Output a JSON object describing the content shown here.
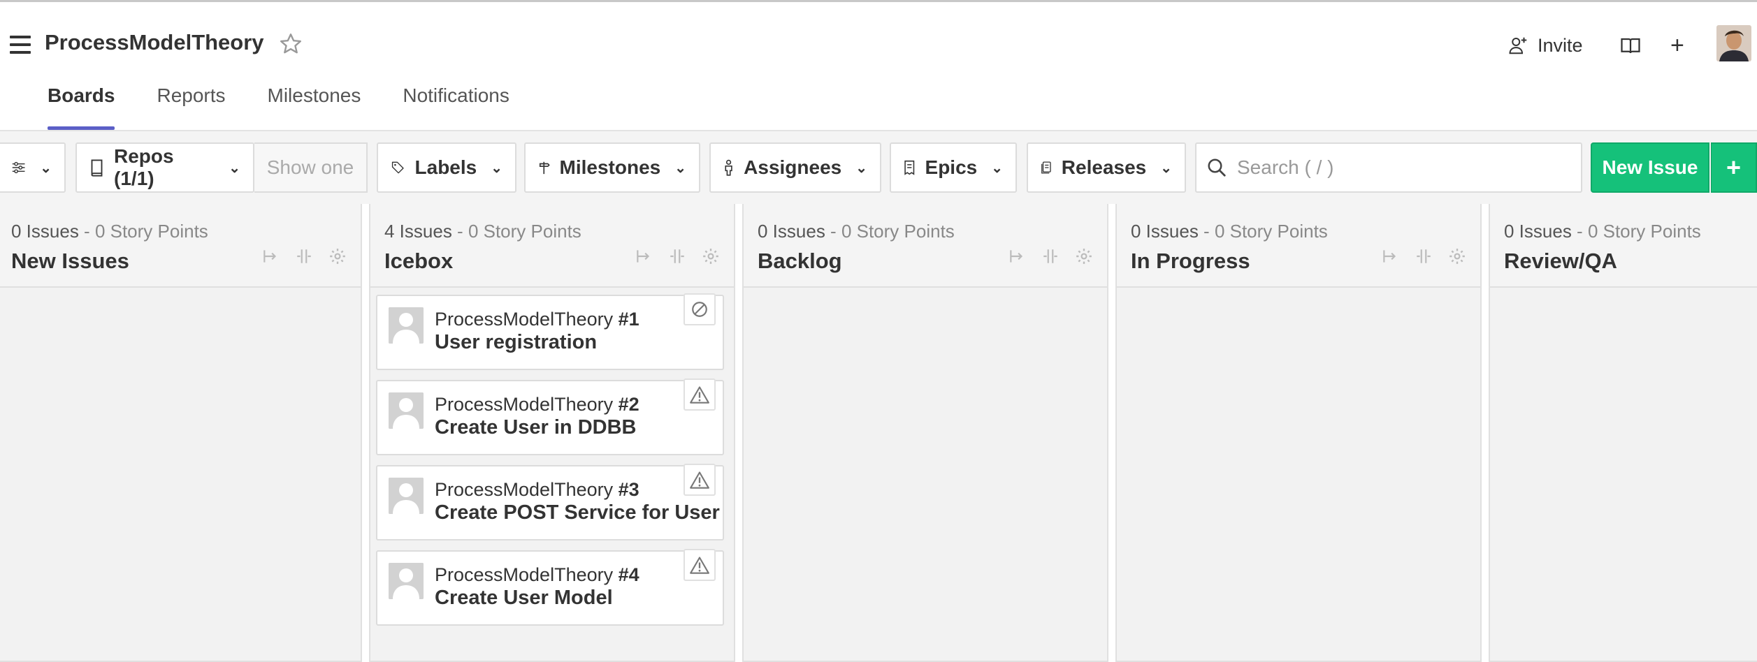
{
  "header": {
    "board_title": "ProcessModelTheory",
    "invite_label": "Invite",
    "icons": [
      "hamburger-menu-icon",
      "star-icon",
      "add-user-icon",
      "book-icon",
      "plus-icon"
    ]
  },
  "tabs": [
    {
      "label": "Boards",
      "active": true
    },
    {
      "label": "Reports",
      "active": false
    },
    {
      "label": "Milestones",
      "active": false
    },
    {
      "label": "Notifications",
      "active": false
    }
  ],
  "filters": {
    "repos": "Repos (1/1)",
    "show_one": "Show one",
    "labels": "Labels",
    "milestones": "Milestones",
    "assignees": "Assignees",
    "epics": "Epics",
    "releases": "Releases",
    "search_placeholder": "Search ( / )",
    "new_issue": "New Issue",
    "new_plus": "+"
  },
  "colors": {
    "accent": "#5b5fc7",
    "new_issue_green": "#15c17a"
  },
  "columns": [
    {
      "issues": "0 Issues",
      "sep": " - ",
      "points": "0 Story Points",
      "name": "New Issues"
    },
    {
      "issues": "4 Issues",
      "sep": " - ",
      "points": "0 Story Points",
      "name": "Icebox"
    },
    {
      "issues": "0 Issues",
      "sep": " - ",
      "points": "0 Story Points",
      "name": "Backlog"
    },
    {
      "issues": "0 Issues",
      "sep": " - ",
      "points": "0 Story Points",
      "name": "In Progress"
    },
    {
      "issues": "0 Issues",
      "sep": " - ",
      "points": "0 Story Points",
      "name": "Review/QA"
    }
  ],
  "cards": [
    {
      "repo": "ProcessModelTheory",
      "number": "#1",
      "title": "User registration",
      "badge": "blocked-icon"
    },
    {
      "repo": "ProcessModelTheory",
      "number": "#2",
      "title": "Create User in DDBB",
      "badge": "warning-icon"
    },
    {
      "repo": "ProcessModelTheory",
      "number": "#3",
      "title": "Create POST Service for User",
      "badge": "warning-icon"
    },
    {
      "repo": "ProcessModelTheory",
      "number": "#4",
      "title": "Create User Model",
      "badge": "warning-icon"
    }
  ]
}
